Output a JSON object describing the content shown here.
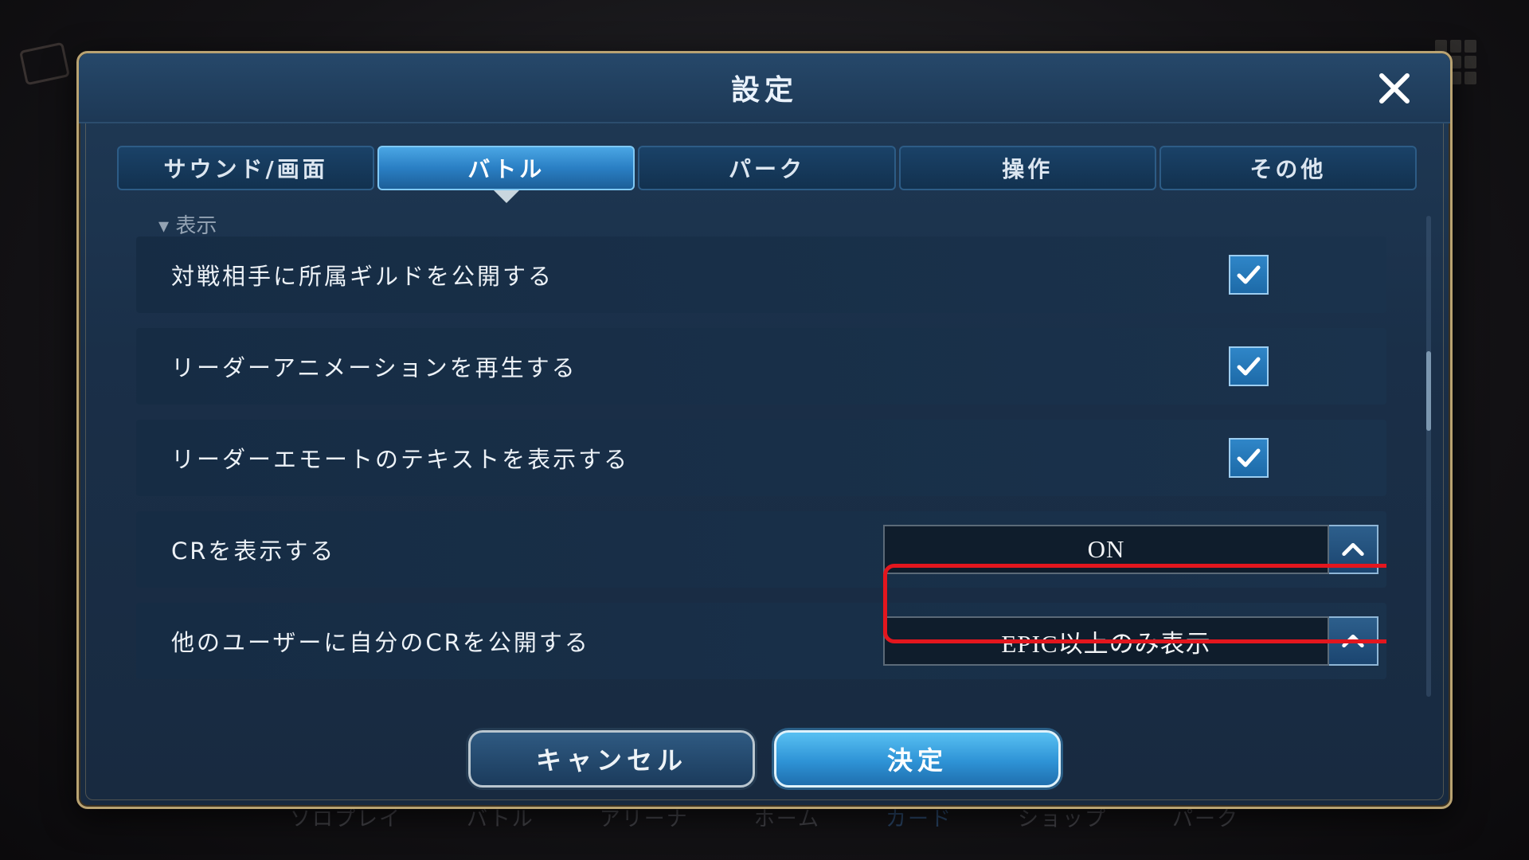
{
  "background": {
    "nav_items": [
      {
        "label": "ソロプレイ"
      },
      {
        "label": "バトル"
      },
      {
        "label": "アリーナ"
      },
      {
        "label": "ホーム"
      },
      {
        "label": "カード"
      },
      {
        "label": "ショップ"
      },
      {
        "label": "パーク"
      }
    ]
  },
  "dialog": {
    "title": "設定",
    "close_icon": "close-icon"
  },
  "tabs": [
    {
      "label": "サウンド/画面",
      "active": false
    },
    {
      "label": "バトル",
      "active": true
    },
    {
      "label": "パーク",
      "active": false
    },
    {
      "label": "操作",
      "active": false
    },
    {
      "label": "その他",
      "active": false
    }
  ],
  "section": {
    "header": "表示"
  },
  "settings": [
    {
      "label": "対戦相手に所属ギルドを公開する",
      "control": "checkbox",
      "checked": true
    },
    {
      "label": "リーダーアニメーションを再生する",
      "control": "checkbox",
      "checked": true
    },
    {
      "label": "リーダーエモートのテキストを表示する",
      "control": "checkbox",
      "checked": true
    },
    {
      "label": "CRを表示する",
      "control": "select",
      "value": "ON"
    },
    {
      "label": "他のユーザーに自分のCRを公開する",
      "control": "select",
      "value": "EPIC以上のみ表示"
    }
  ],
  "footer": {
    "cancel_label": "キャンセル",
    "ok_label": "決定"
  },
  "colors": {
    "accent": "#2e93d6",
    "highlight": "#e3161e",
    "frame": "#b9a372"
  }
}
